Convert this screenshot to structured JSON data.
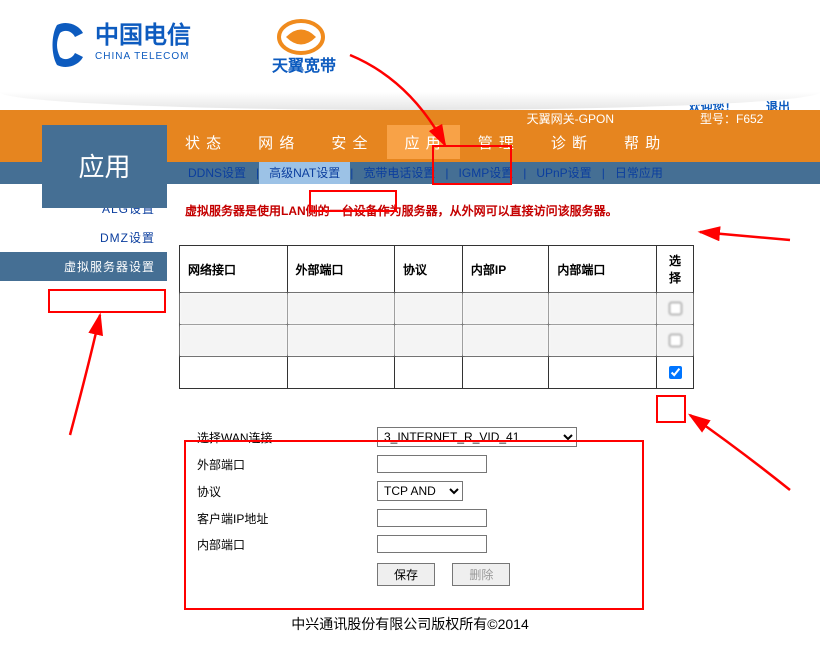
{
  "branding": {
    "telecom_cn": "中国电信",
    "telecom_en": "CHINA TELECOM",
    "sub_brand": "天翼宽带"
  },
  "header_links": {
    "welcome": "欢迎您！",
    "logout": "退出"
  },
  "device": {
    "name_label": "天翼网关-GPON",
    "model_label": "型号：F652"
  },
  "page_title": "应用",
  "nav": [
    "状 态",
    "网 络",
    "安 全",
    "应 用",
    "管 理",
    "诊 断",
    "帮 助"
  ],
  "nav_active_index": 3,
  "subnav": [
    "DDNS设置",
    "高级NAT设置",
    "宽带电话设置",
    "IGMP设置",
    "UPnP设置",
    "日常应用"
  ],
  "subnav_active_index": 1,
  "sidebar": [
    "ALG设置",
    "DMZ设置",
    "虚拟服务器设置"
  ],
  "sidebar_active_index": 2,
  "description": "虚拟服务器是使用LAN侧的一台设备作为服务器，从外网可以直接访问该服务器。",
  "table": {
    "headers": [
      "网络接口",
      "外部端口",
      "协议",
      "内部IP",
      "内部端口",
      "选择"
    ],
    "rows": [
      {
        "selected": false
      },
      {
        "selected": false
      },
      {
        "selected": true
      }
    ]
  },
  "form": {
    "wan_label": "选择WAN连接",
    "wan_value": "3_INTERNET_R_VID_41",
    "ext_port_label": "外部端口",
    "ext_port_value": "",
    "proto_label": "协议",
    "proto_value": "TCP AND",
    "client_ip_label": "客户端IP地址",
    "client_ip_value": "",
    "int_port_label": "内部端口",
    "int_port_value": "",
    "save_label": "保存",
    "delete_label": "删除"
  },
  "footer": "中兴通讯股份有限公司版权所有©2014"
}
